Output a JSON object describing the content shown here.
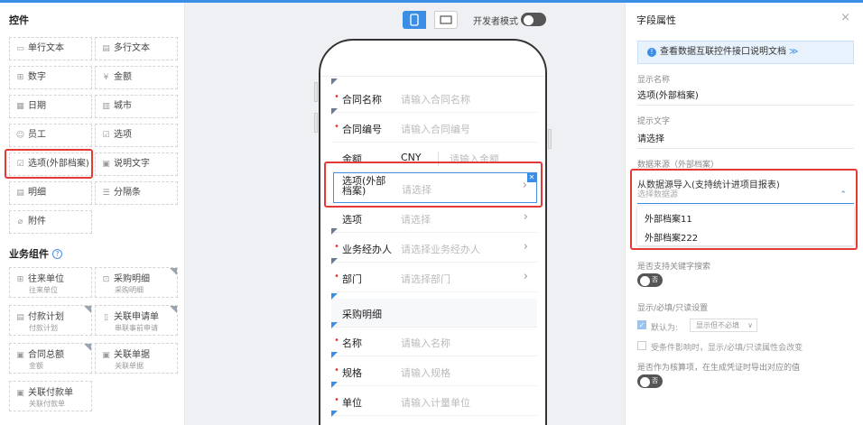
{
  "controls": {
    "title": "控件",
    "items": [
      {
        "label": "单行文本",
        "icon": "text-line-icon"
      },
      {
        "label": "多行文本",
        "icon": "text-area-icon"
      },
      {
        "label": "数字",
        "icon": "number-icon"
      },
      {
        "label": "金额",
        "icon": "money-icon"
      },
      {
        "label": "日期",
        "icon": "calendar-icon"
      },
      {
        "label": "城市",
        "icon": "city-icon"
      },
      {
        "label": "员工",
        "icon": "user-icon"
      },
      {
        "label": "选项",
        "icon": "checkbox-icon"
      },
      {
        "label": "选项(外部档案)",
        "icon": "checkbox-icon"
      },
      {
        "label": "说明文字",
        "icon": "note-icon"
      },
      {
        "label": "明细",
        "icon": "detail-icon"
      },
      {
        "label": "分隔条",
        "icon": "divider-icon"
      },
      {
        "label": "附件",
        "icon": "paperclip-icon"
      }
    ]
  },
  "business": {
    "title": "业务组件",
    "items": [
      {
        "label": "往来单位",
        "sub": "往来单位"
      },
      {
        "label": "采购明细",
        "sub": "采购明细"
      },
      {
        "label": "付款计划",
        "sub": "付款计划"
      },
      {
        "label": "关联申请单",
        "sub": "串联事前申请"
      },
      {
        "label": "合同总额",
        "sub": "金额"
      },
      {
        "label": "关联单据",
        "sub": "关联单据"
      },
      {
        "label": "关联付款单",
        "sub": "关联付款单"
      }
    ]
  },
  "toolbar": {
    "dev_mode_label": "开发者模式"
  },
  "form": {
    "rows": [
      {
        "label": "合同名称",
        "placeholder": "请输入合同名称",
        "required": "•"
      },
      {
        "label": "合同编号",
        "placeholder": "请输入合同编号",
        "required": "•"
      },
      {
        "label": "金额",
        "currency": "CNY",
        "placeholder": "请输入金额"
      },
      {
        "label": "选项(外部\n档案)",
        "label_line1": "选项(外部",
        "label_line2": "档案)",
        "placeholder": "请选择"
      },
      {
        "label": "选项",
        "placeholder": "请选择"
      },
      {
        "label": "业务经办人",
        "placeholder": "请选择业务经办人",
        "required": "•"
      },
      {
        "label": "部门",
        "placeholder": "请选择部门",
        "required": "•"
      },
      {
        "label": "采购明细"
      },
      {
        "label": "名称",
        "placeholder": "请输入名称",
        "required": "•"
      },
      {
        "label": "规格",
        "placeholder": "请输入规格",
        "required": "•"
      },
      {
        "label": "单位",
        "placeholder": "请输入计量单位",
        "required": "•"
      }
    ]
  },
  "props": {
    "title": "字段属性",
    "info_text": "查看数据互联控件接口说明文档",
    "info_more": "≫",
    "display_name_label": "显示名称",
    "display_name_value": "选项(外部档案)",
    "hint_label": "提示文字",
    "hint_value": "请选择",
    "source_label": "数据来源（外部档案）",
    "source_head": "从数据源导入(支持统计进项目报表)",
    "source_placeholder": "选择数据源",
    "source_options": [
      "外部档案11",
      "外部档案222"
    ],
    "keyword_label": "是否支持关键字搜索",
    "toggle_no": "否",
    "visibility_label": "显示/必填/只读设置",
    "default_label": "默认为:",
    "default_value": "显示但不必填",
    "cond_label": "受条件影响时，显示/必填/只读属性会改变",
    "voucher_label": "是否作为核算项，在生成凭证时导出对应的值"
  }
}
